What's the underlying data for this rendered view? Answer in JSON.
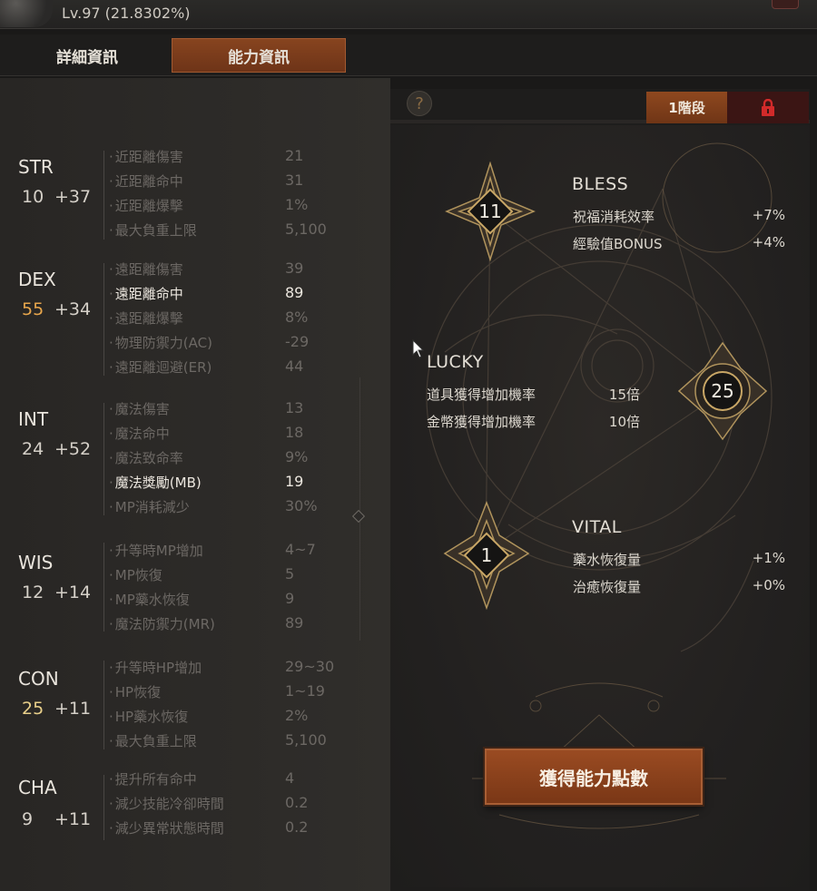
{
  "header": {
    "level_text": "Lv.97 (21.8302%)"
  },
  "tabs": [
    {
      "label": "詳細資訊",
      "active": false
    },
    {
      "label": "能力資訊",
      "active": true
    }
  ],
  "stats": [
    {
      "name": "STR",
      "base": "10",
      "bonus": "+37",
      "rows": [
        {
          "label": "近距離傷害",
          "value": "21",
          "bright": false
        },
        {
          "label": "近距離命中",
          "value": "31",
          "bright": false
        },
        {
          "label": "近距離爆擊",
          "value": "1%",
          "bright": false
        },
        {
          "label": "最大負重上限",
          "value": "5,100",
          "bright": false
        }
      ]
    },
    {
      "name": "DEX",
      "base": "55",
      "bonus": "+34",
      "rows": [
        {
          "label": "遠距離傷害",
          "value": "39",
          "bright": false
        },
        {
          "label": "遠距離命中",
          "value": "89",
          "bright": true
        },
        {
          "label": "遠距離爆擊",
          "value": "8%",
          "bright": false
        },
        {
          "label": "物理防禦力(AC)",
          "value": "-29",
          "bright": false
        },
        {
          "label": "遠距離迴避(ER)",
          "value": "44",
          "bright": false
        }
      ]
    },
    {
      "name": "INT",
      "base": "24",
      "bonus": "+52",
      "rows": [
        {
          "label": "魔法傷害",
          "value": "13",
          "bright": false
        },
        {
          "label": "魔法命中",
          "value": "18",
          "bright": false
        },
        {
          "label": "魔法致命率",
          "value": "9%",
          "bright": false
        },
        {
          "label": "魔法獎勵(MB)",
          "value": "19",
          "bright": true
        },
        {
          "label": "MP消耗減少",
          "value": "30%",
          "bright": false
        }
      ]
    },
    {
      "name": "WIS",
      "base": "12",
      "bonus": "+14",
      "rows": [
        {
          "label": "升等時MP增加",
          "value": "4~7",
          "bright": false
        },
        {
          "label": "MP恢復",
          "value": "5",
          "bright": false
        },
        {
          "label": "MP藥水恢復",
          "value": "9",
          "bright": false
        },
        {
          "label": "魔法防禦力(MR)",
          "value": "89",
          "bright": false
        }
      ]
    },
    {
      "name": "CON",
      "base": "25",
      "bonus": "+11",
      "rows": [
        {
          "label": "升等時HP增加",
          "value": "29~30",
          "bright": false
        },
        {
          "label": "HP恢復",
          "value": "1~19",
          "bright": false
        },
        {
          "label": "HP藥水恢復",
          "value": "2%",
          "bright": false
        },
        {
          "label": "最大負重上限",
          "value": "5,100",
          "bright": false
        }
      ]
    },
    {
      "name": "CHA",
      "base": "9",
      "bonus": "+11",
      "rows": [
        {
          "label": "提升所有命中",
          "value": "4",
          "bright": false
        },
        {
          "label": "減少技能冷卻時間",
          "value": "0.2",
          "bright": false
        },
        {
          "label": "減少異常狀態時間",
          "value": "0.2",
          "bright": false
        }
      ]
    }
  ],
  "right": {
    "help": "?",
    "stage_label": "1階段",
    "nodes": {
      "bless": "11",
      "lucky": "25",
      "vital": "1"
    },
    "bless": {
      "title": "BLESS",
      "effects": [
        {
          "label": "祝福消耗效率",
          "value": "+7%"
        },
        {
          "label": "經驗值BONUS",
          "value": "+4%"
        }
      ]
    },
    "lucky": {
      "title": "LUCKY",
      "effects": [
        {
          "label": "道具獲得增加機率",
          "value": "15倍"
        },
        {
          "label": "金幣獲得增加機率",
          "value": "10倍"
        }
      ]
    },
    "vital": {
      "title": "VITAL",
      "effects": [
        {
          "label": "藥水恢復量",
          "value": "+1%"
        },
        {
          "label": "治癒恢復量",
          "value": "+0%"
        }
      ]
    },
    "get_points_button": "獲得能力點數"
  },
  "colors": {
    "accent": "#8f481f",
    "highlight_value": "#e8a64c",
    "gold": "#c9a766"
  }
}
